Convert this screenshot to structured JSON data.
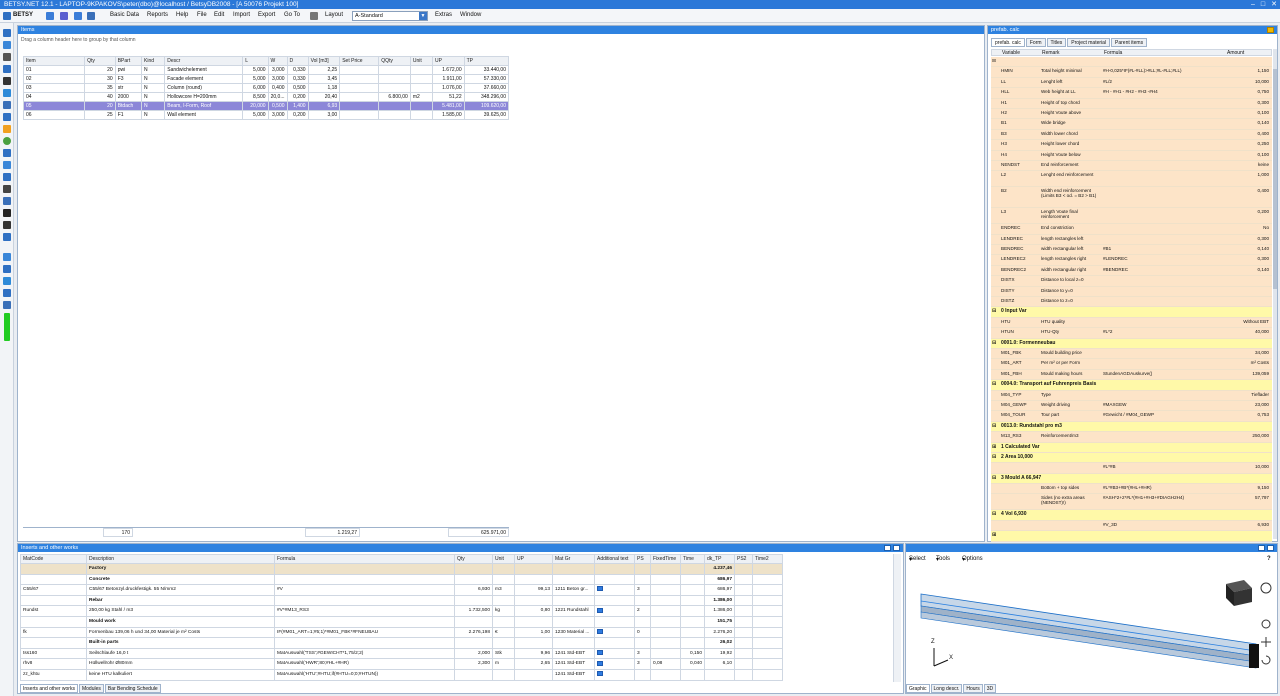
{
  "title": "BETSY.NET 12.1 - LAPTOP-9KPAKOVS\\peter(dbo)@localhost / BetsyDB2008 - [A 50076 Projekt 100]",
  "menu": {
    "app": "BETSY",
    "items": [
      "Basic Data",
      "Reports",
      "Help",
      "File",
      "Edit",
      "Import",
      "Export",
      "Go To"
    ],
    "layout_label": "Layout",
    "layout_value": "A-Standard",
    "extra": [
      "Extras",
      "Window"
    ]
  },
  "items_panel": {
    "title": "Items",
    "group_hint": "Drag a column header here to group by that column",
    "columns": [
      "Item",
      "Qty",
      "BPart",
      "Kind",
      "Descr",
      "L",
      "W",
      "D",
      "Vol [m3]",
      "Set Price",
      "QQty",
      "Unit",
      "UP",
      "TP"
    ],
    "rows": [
      [
        "01",
        "20",
        "pwi",
        "N",
        "Sandwichelement",
        "5,000",
        "3,000",
        "0,330",
        "2,25",
        "",
        "",
        "",
        "1.672,00",
        "33.440,00"
      ],
      [
        "02",
        "30",
        "F3",
        "N",
        "Facade element",
        "5,000",
        "3,000",
        "0,330",
        "3,45",
        "",
        "",
        "",
        "1.911,00",
        "57.330,00"
      ],
      [
        "03",
        "35",
        "str",
        "N",
        "Column (round)",
        "6,000",
        "0,400",
        "0,500",
        "1,18",
        "",
        "",
        "",
        "1.076,00",
        "37.660,00"
      ],
      [
        "04",
        "40",
        "2000",
        "N",
        "Hollowcore H=200mm",
        "8,500",
        "20,0...",
        "0,200",
        "20,40",
        "",
        "6.800,00",
        "m2",
        "51,22",
        "348.296,00"
      ],
      [
        "05",
        "20",
        "Btdach",
        "N",
        "Beam, I-Form, Roof",
        "20,000",
        "0,500",
        "1,400",
        "6,93",
        "",
        "",
        "",
        "5.481,00",
        "109.620,00"
      ],
      [
        "06",
        "25",
        "F1",
        "N",
        "Wall element",
        "5,000",
        "3,000",
        "0,200",
        "3,00",
        "",
        "",
        "",
        "1.585,00",
        "39.625,00"
      ]
    ],
    "selected_row": 4,
    "footer": {
      "qty": "170",
      "vol": "1.219,27",
      "tp": "625.971,00"
    }
  },
  "right_panel": {
    "tabs": [
      "prefab. calc",
      "Form",
      "Titles",
      "Project material",
      "Parent items"
    ],
    "header_title": "prefab. calc",
    "columns": [
      "Variable",
      "Remark",
      "Formula",
      "Amount"
    ],
    "rows": [
      {
        "k": "v",
        "var": "",
        "rem": "",
        "form": "",
        "amt": "",
        "exp": "⊟"
      },
      {
        "k": "v",
        "var": "HMIN",
        "rem": "Total height minimal",
        "form": "#H-0,025*IF(#L-#LL)>#LL;#L-#LL;#LL)",
        "amt": "1,150"
      },
      {
        "k": "v",
        "var": "LL",
        "rem": "Lenght left",
        "form": "#L/2",
        "amt": "10,000"
      },
      {
        "k": "v",
        "var": "HLL",
        "rem": "Web height at LL",
        "form": "#H - #H1 - #H2 - #H3 -#H4",
        "amt": "0,750"
      },
      {
        "k": "v",
        "var": "H1",
        "rem": "Height of top chord",
        "form": "",
        "amt": "0,300"
      },
      {
        "k": "v",
        "var": "H2",
        "rem": "Height Voute above",
        "form": "",
        "amt": "0,100"
      },
      {
        "k": "v",
        "var": "B1",
        "rem": "Wide bridge",
        "form": "",
        "amt": "0,140"
      },
      {
        "k": "v",
        "var": "B3",
        "rem": "Width lower chord",
        "form": "",
        "amt": "0,400"
      },
      {
        "k": "v",
        "var": "H3",
        "rem": "Height lower chord",
        "form": "",
        "amt": "0,250"
      },
      {
        "k": "v",
        "var": "H4",
        "rem": "Height Voute below",
        "form": "",
        "amt": "0,100"
      },
      {
        "k": "v",
        "var": "NENDST",
        "rem": "End reinforcement",
        "form": "",
        "amt": "keine"
      },
      {
        "k": "vt",
        "var": "L2",
        "rem": "Lenght end reinforcement",
        "form": "",
        "amt": "1,000"
      },
      {
        "k": "vb",
        "var": "B2",
        "rem": "Width end reinforcement (Limits B3 < od. = B2 > B1)",
        "form": "",
        "amt": "0,400"
      },
      {
        "k": "vt",
        "var": "L3",
        "rem": "Length Voute final reinforcement",
        "form": "",
        "amt": "0,200"
      },
      {
        "k": "v",
        "var": "ENDREC",
        "rem": "End constriction",
        "form": "",
        "amt": "No"
      },
      {
        "k": "v",
        "var": "LENDREC",
        "rem": "length rectangles left",
        "form": "",
        "amt": "0,300"
      },
      {
        "k": "v",
        "var": "BENDREC",
        "rem": "width rectangular left",
        "form": "#B1",
        "amt": "0,140"
      },
      {
        "k": "v",
        "var": "LENDREC2",
        "rem": "length rectangles right",
        "form": "#LENDREC",
        "amt": "0,300"
      },
      {
        "k": "v",
        "var": "BENDREC2",
        "rem": "width rectangular right",
        "form": "#BENDREC",
        "amt": "0,140"
      },
      {
        "k": "v",
        "var": "DISTX",
        "rem": "Distance to local z=0",
        "form": "",
        "amt": ""
      },
      {
        "k": "v",
        "var": "DISTY",
        "rem": "Distance to y=0",
        "form": "",
        "amt": ""
      },
      {
        "k": "v",
        "var": "DISTZ",
        "rem": "Distance to z=0",
        "form": "",
        "amt": ""
      },
      {
        "k": "s",
        "var": "",
        "rem": "0  Input Var",
        "form": "",
        "amt": "",
        "exp": "⊟"
      },
      {
        "k": "v",
        "var": "HTU",
        "rem": "HTU quality",
        "form": "",
        "amt": "Without EBT"
      },
      {
        "k": "v",
        "var": "HTUN",
        "rem": "HTU-Qty",
        "form": "#L*2",
        "amt": "40,000"
      },
      {
        "k": "s",
        "var": "",
        "rem": "0001.0: Formenneubau",
        "form": "",
        "amt": "",
        "exp": "⊟"
      },
      {
        "k": "v",
        "var": "M01_FBK",
        "rem": "Mould building price",
        "form": "",
        "amt": "34,000"
      },
      {
        "k": "v",
        "var": "M01_ART",
        "rem": "Per m² or per Form",
        "form": "",
        "amt": "m² Costs"
      },
      {
        "k": "v",
        "var": "M01_FBH",
        "rem": "Mould making hours",
        "form": "StundenAGDAuskurve()",
        "amt": "139,059"
      },
      {
        "k": "s",
        "var": "",
        "rem": "0004.0: Transport auf Fuhrenpreis Basis",
        "form": "",
        "amt": "",
        "exp": "⊟"
      },
      {
        "k": "v",
        "var": "M04_TYP",
        "rem": "Type",
        "form": "",
        "amt": "Tieflader"
      },
      {
        "k": "v",
        "var": "M04_GEWP",
        "rem": "Weight driving",
        "form": "#MAXGEW",
        "amt": "23,000"
      },
      {
        "k": "v",
        "var": "M04_TOUR",
        "rem": "Tour part",
        "form": "#Gewicht / #M04_GEWP",
        "amt": "0,753"
      },
      {
        "k": "s",
        "var": "",
        "rem": "0013.0: Rundstahl pro m3",
        "form": "",
        "amt": "",
        "exp": "⊟"
      },
      {
        "k": "v",
        "var": "M13_RS3",
        "rem": "Reinforcement/m3",
        "form": "",
        "amt": "250,000"
      },
      {
        "k": "s",
        "var": "",
        "rem": "1 Calculated Var",
        "form": "",
        "amt": "",
        "exp": "⊞"
      },
      {
        "k": "s",
        "var": "",
        "rem": "2 Area 10,000",
        "form": "",
        "amt": "",
        "exp": "⊟"
      },
      {
        "k": "v",
        "var": "",
        "rem": "",
        "form": "#L*#B",
        "amt": "10,000"
      },
      {
        "k": "s",
        "var": "",
        "rem": "3 Mould A 66,947",
        "form": "",
        "amt": "",
        "exp": "⊟"
      },
      {
        "k": "v",
        "var": "",
        "rem": "Bottom + top sides",
        "form": "#L*#B3+#B*(#HL+#HR)",
        "amt": "9,150"
      },
      {
        "k": "vt",
        "var": "",
        "rem": "Sides (no extra areas (NENDST)!)",
        "form": "#ASH*2+2*#L*(#H1+#H3+#DIAGH2H4)",
        "amt": "57,797"
      },
      {
        "k": "s",
        "var": "",
        "rem": "4 Vol 6,930",
        "form": "",
        "amt": "",
        "exp": "⊟"
      },
      {
        "k": "v",
        "var": "",
        "rem": "",
        "form": "#V_3D",
        "amt": "6,930"
      },
      {
        "k": "s",
        "var": "",
        "rem": "",
        "form": "",
        "amt": "",
        "exp": "⊞"
      }
    ]
  },
  "inserts_panel": {
    "title": "Inserts and other works",
    "columns": [
      "MatCode",
      "Description",
      "Formula",
      "Qty",
      "Unit",
      "UP",
      "Mat Gr",
      "Additional text",
      "PS",
      "FixedTime",
      "Time",
      "dk_TP",
      "PS2",
      "Time2"
    ],
    "rows": [
      {
        "k": "cat",
        "c": [
          "",
          "Factory",
          "",
          "",
          "",
          "",
          "",
          "",
          "",
          "",
          "",
          "4.237,46",
          "",
          ""
        ]
      },
      {
        "k": "subcat",
        "c": [
          "",
          "Concrete",
          "",
          "",
          "",
          "",
          "",
          "",
          "",
          "",
          "",
          "686,97",
          "",
          ""
        ]
      },
      {
        "k": "row",
        "c": [
          "C55/67",
          "C55/67 Betonzyl.druckfestigk. 55 N/mm2",
          "#V",
          "6,930",
          "m3",
          "99,13",
          "1211 Beton gr...",
          "chk",
          "3",
          "",
          "",
          "686,97",
          "",
          ""
        ]
      },
      {
        "k": "subcat",
        "c": [
          "",
          "Rebar",
          "",
          "",
          "",
          "",
          "",
          "",
          "",
          "",
          "",
          "1.386,00",
          "",
          ""
        ]
      },
      {
        "k": "row",
        "c": [
          "Rundst",
          "250,00 kg Stahl / m3",
          "#V*#M13_RS3",
          "1.732,500",
          "kg",
          "0,80",
          "1221 Rundstahl",
          "chk",
          "2",
          "",
          "",
          "1.386,00",
          "",
          ""
        ]
      },
      {
        "k": "subcat",
        "c": [
          "",
          "Mould work",
          "",
          "",
          "",
          "",
          "",
          "",
          "",
          "",
          "",
          "151,75",
          "",
          ""
        ]
      },
      {
        "k": "row",
        "c": [
          "fk",
          "Formenbau 139,06 h und 34,00 Material je m² Costs",
          "IF(#M01_ART=1;#5;1)*#M01_FBK*#FNEUBAU",
          "2.276,198",
          "€",
          "1,00",
          "1230 Material ...",
          "chk",
          "0",
          "",
          "",
          "2.276,20",
          "",
          ""
        ]
      },
      {
        "k": "subcat",
        "c": [
          "",
          "Built-in parts",
          "",
          "",
          "",
          "",
          "",
          "",
          "",
          "",
          "",
          "26,02",
          "",
          ""
        ]
      },
      {
        "k": "row",
        "c": [
          "tss160",
          "Seilschlaufe 16,0 t",
          "MatAuswahl('TSS';#GEWICHT*1,75/2;2)",
          "2,000",
          "Stk",
          "9,96",
          "1241 Std-EBT",
          "chk",
          "3",
          "",
          "0,150",
          "19,92",
          "",
          ""
        ]
      },
      {
        "k": "row",
        "c": [
          "rhv8",
          "Hüllwellrohr Ø80mm",
          "MatAuswahl('HWR';80;#HL+#HR)",
          "2,300",
          "m",
          "2,65",
          "1241 Std-EBT",
          "chk",
          "3",
          "0,08",
          "0,040",
          "6,10",
          "",
          ""
        ]
      },
      {
        "k": "row",
        "c": [
          "zz_khtu",
          "keine HTU kalkuliert",
          "MatAuswahl('HTU';#HTU;if(#HTU=0;0;#HTUN))",
          "",
          "",
          "",
          "1241 Std-EBT",
          "chk",
          "",
          "",
          "",
          "",
          "",
          ""
        ]
      }
    ],
    "bottom_tabs": [
      "Inserts and other works",
      "Modules",
      "Bar Bending Schedule"
    ]
  },
  "graphic_panel": {
    "tools": [
      "Select",
      "Tools",
      "Options"
    ],
    "help": "?",
    "axis_z": "Z",
    "axis_x": "X",
    "bottom_tabs": [
      "Graphic",
      "Long descr.",
      "Hours",
      "3D"
    ]
  },
  "colors": {
    "titlebar": "#2b78d8",
    "panel_header": "#2e82e0",
    "selected_row": "#8c87d8",
    "variable_bg": "#fde4c8",
    "section_bg": "#fff9a8"
  }
}
